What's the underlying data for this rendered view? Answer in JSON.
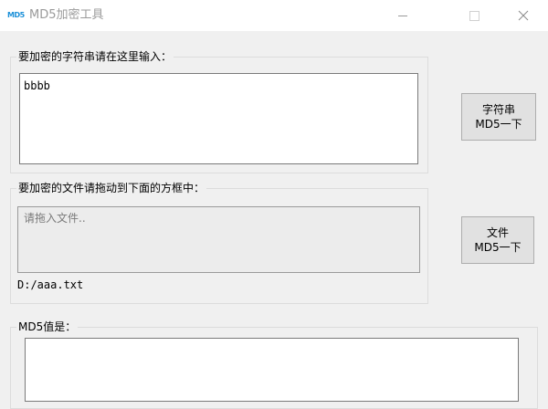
{
  "window": {
    "icon_text": "MD5",
    "title": "MD5加密工具",
    "minimize_icon": "minimize-icon",
    "maximize_icon": "maximize-icon",
    "close_icon": "close-icon"
  },
  "string_group": {
    "label": "要加密的字符串请在这里输入：",
    "input_value": "bbbb",
    "button_line1": "字符串",
    "button_line2": "MD5一下"
  },
  "file_group": {
    "label": "要加密的文件请拖动到下面的方框中：",
    "drop_placeholder": "请拖入文件..",
    "file_path": "D:/aaa.txt",
    "button_line1": "文件",
    "button_line2": "MD5一下"
  },
  "result_group": {
    "label": "MD5值是：",
    "output_value": ""
  }
}
